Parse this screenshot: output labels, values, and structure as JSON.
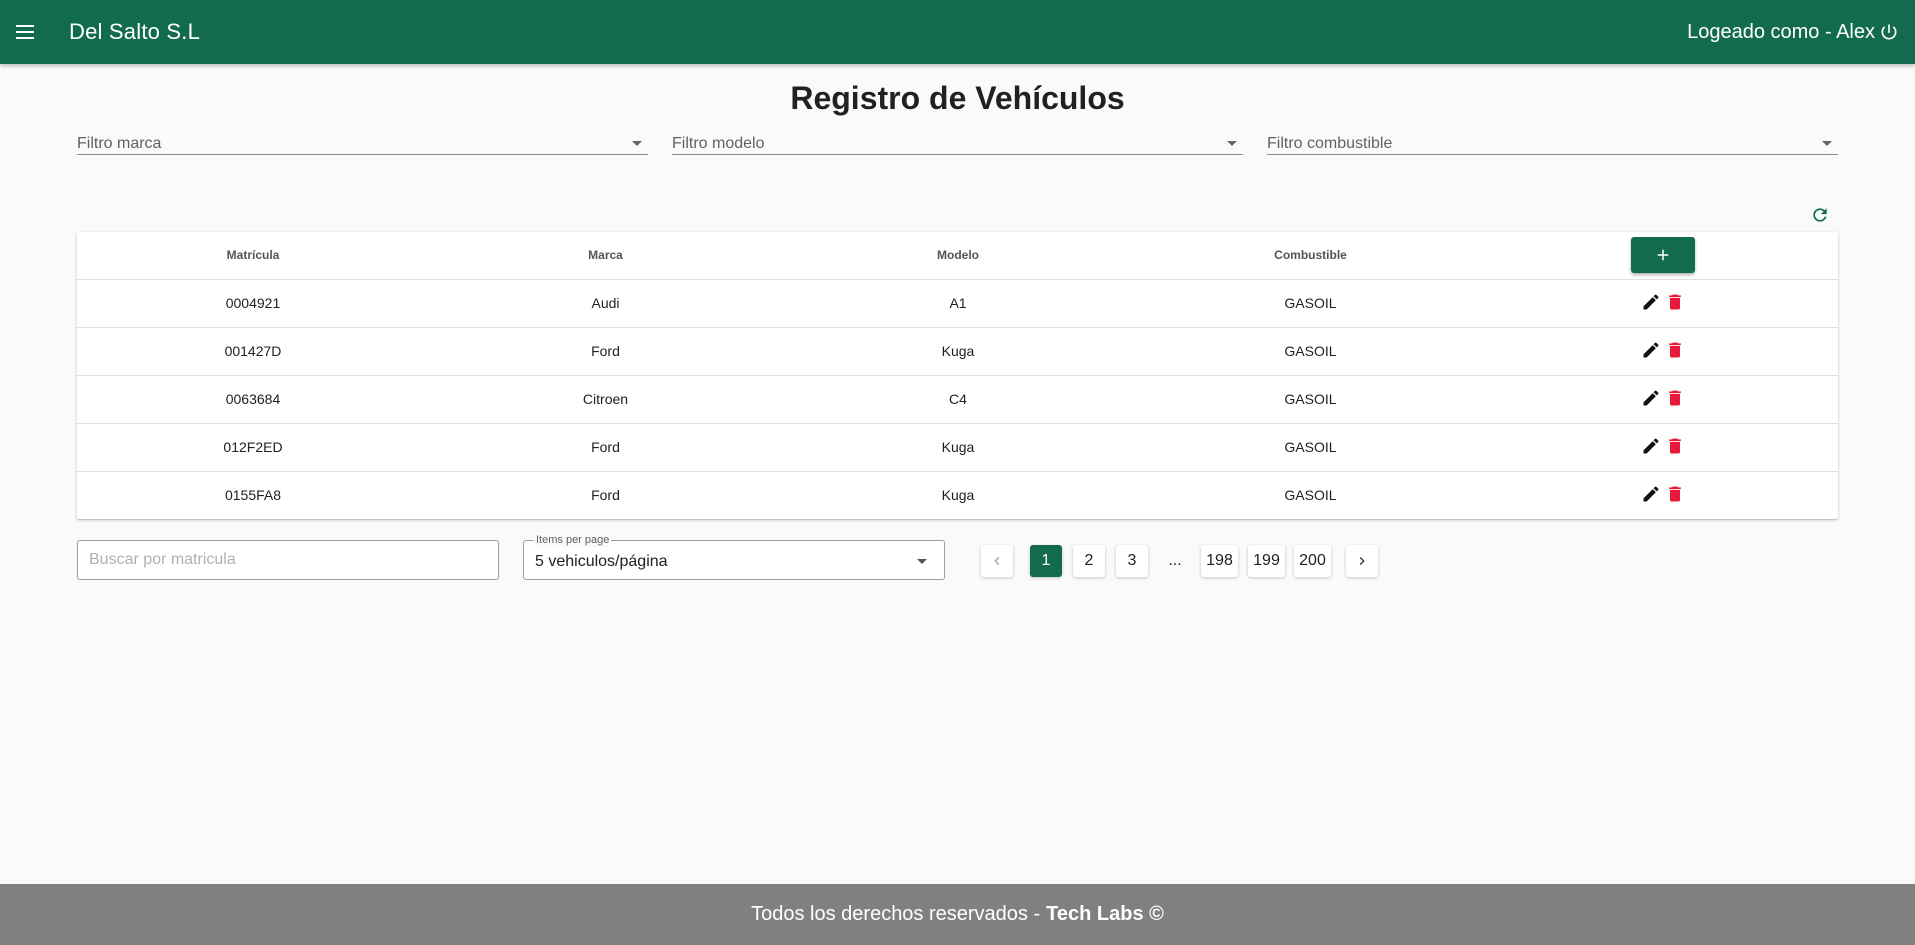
{
  "header": {
    "app_title": "Del Salto S.L",
    "logged_in_text": "Logeado como - Alex"
  },
  "page": {
    "title": "Registro de Vehículos"
  },
  "filters": {
    "brand_placeholder": "Filtro marca",
    "model_placeholder": "Filtro modelo",
    "fuel_placeholder": "Filtro combustible"
  },
  "table": {
    "columns": {
      "plate": "Matrícula",
      "brand": "Marca",
      "model": "Modelo",
      "fuel": "Combustible"
    },
    "rows": [
      {
        "plate": "0004921",
        "brand": "Audi",
        "model": "A1",
        "fuel": "GASOIL"
      },
      {
        "plate": "001427D",
        "brand": "Ford",
        "model": "Kuga",
        "fuel": "GASOIL"
      },
      {
        "plate": "0063684",
        "brand": "Citroen",
        "model": "C4",
        "fuel": "GASOIL"
      },
      {
        "plate": "012F2ED",
        "brand": "Ford",
        "model": "Kuga",
        "fuel": "GASOIL"
      },
      {
        "plate": "0155FA8",
        "brand": "Ford",
        "model": "Kuga",
        "fuel": "GASOIL"
      }
    ]
  },
  "search": {
    "placeholder": "Buscar por matricula",
    "value": ""
  },
  "items_per_page": {
    "label": "Items per page",
    "selected": "5 vehiculos/página"
  },
  "pagination": {
    "pages": [
      "1",
      "2",
      "3",
      "198",
      "199",
      "200"
    ],
    "ellipsis": "...",
    "current": "1"
  },
  "footer": {
    "text": "Todos los derechos reservados - ",
    "brand": "Tech Labs ©"
  },
  "colors": {
    "primary": "#136b4f",
    "delete": "#e8183c",
    "footer_bg": "#808080"
  },
  "icons": {
    "menu": "menu-icon",
    "power": "power-icon",
    "refresh": "refresh-icon",
    "add": "plus-icon",
    "edit": "pencil-icon",
    "delete": "trash-icon",
    "prev": "chevron-left-icon",
    "next": "chevron-right-icon",
    "dropdown": "caret-down-icon"
  }
}
